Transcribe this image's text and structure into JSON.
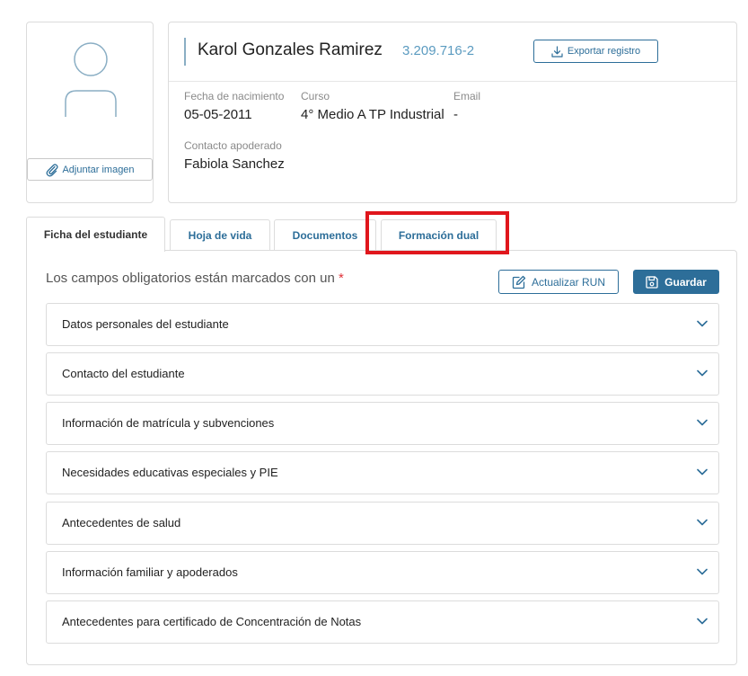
{
  "photo": {
    "attach_label": "Adjuntar imagen"
  },
  "student": {
    "name": "Karol Gonzales Ramirez",
    "run": "3.209.716-2",
    "export_label": "Exportar registro",
    "fields": {
      "birth_label": "Fecha de nacimiento",
      "birth_value": "05-05-2011",
      "course_label": "Curso",
      "course_value": "4° Medio A TP Industrial",
      "email_label": "Email",
      "email_value": "-",
      "guardian_label": "Contacto apoderado",
      "guardian_value": "Fabiola Sanchez"
    }
  },
  "tabs": [
    {
      "label": "Ficha del estudiante",
      "active": true
    },
    {
      "label": "Hoja de vida",
      "active": false
    },
    {
      "label": "Documentos",
      "active": false
    },
    {
      "label": "Formación dual",
      "active": false
    }
  ],
  "form": {
    "required_note": "Los campos obligatorios están marcados con un",
    "required_star": "*",
    "update_run_label": "Actualizar RUN",
    "save_label": "Guardar",
    "sections": [
      "Datos personales del estudiante",
      "Contacto del estudiante",
      "Información de matrícula y subvenciones",
      "Necesidades educativas especiales y PIE",
      "Antecedentes de salud",
      "Información familiar y apoderados",
      "Antecedentes para certificado de Concentración de Notas"
    ]
  },
  "colors": {
    "primary": "#2d6e99",
    "run_text": "#5b9bc0",
    "highlight": "#e0161c",
    "required_star": "#e0333a"
  }
}
